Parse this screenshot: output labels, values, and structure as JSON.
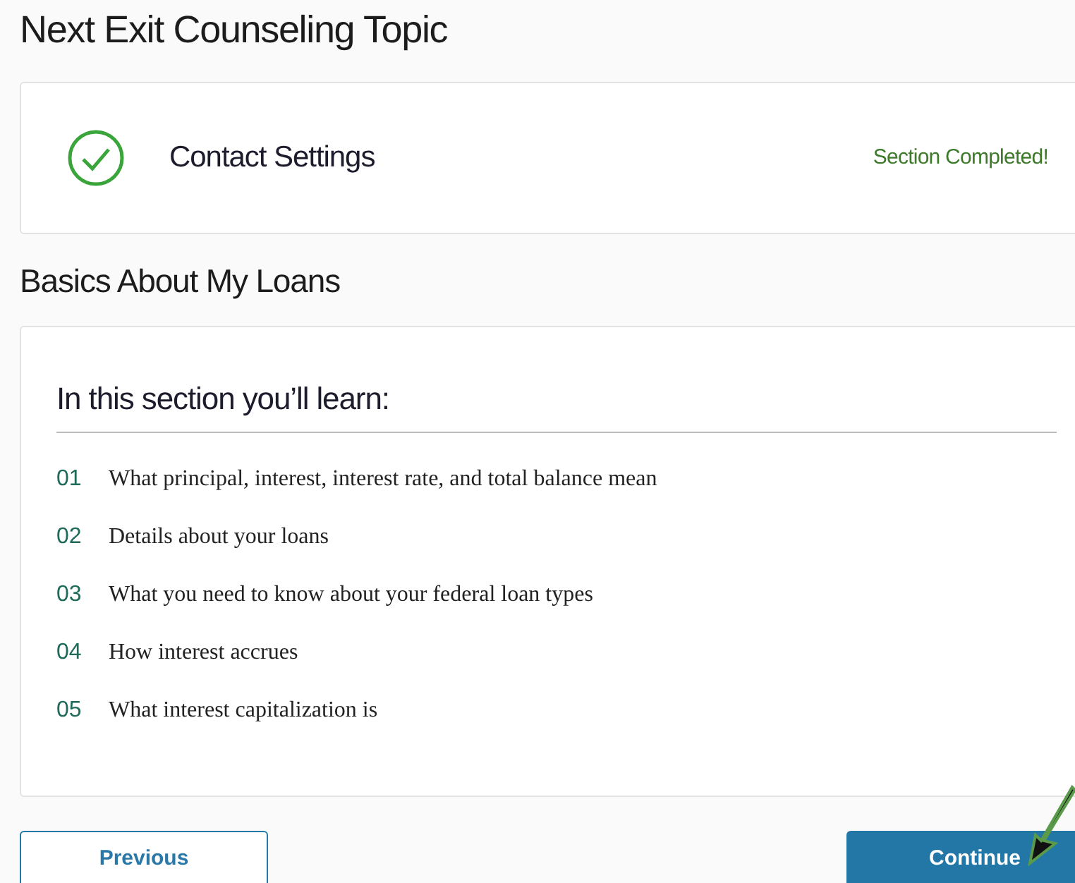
{
  "page_title": "Next Exit Counseling Topic",
  "completed_topic": {
    "title": "Contact Settings",
    "status": "Section Completed!",
    "completed": true
  },
  "section": {
    "title": "Basics About My Loans",
    "intro": "In this section you’ll learn:",
    "items": [
      {
        "number": "01",
        "text": "What principal, interest, interest rate, and total balance mean"
      },
      {
        "number": "02",
        "text": "Details about your loans"
      },
      {
        "number": "03",
        "text": "What you need to know about your federal loan types"
      },
      {
        "number": "04",
        "text": "How interest accrues"
      },
      {
        "number": "05",
        "text": "What interest capitalization is"
      }
    ]
  },
  "buttons": {
    "previous": "Previous",
    "continue": "Continue"
  }
}
